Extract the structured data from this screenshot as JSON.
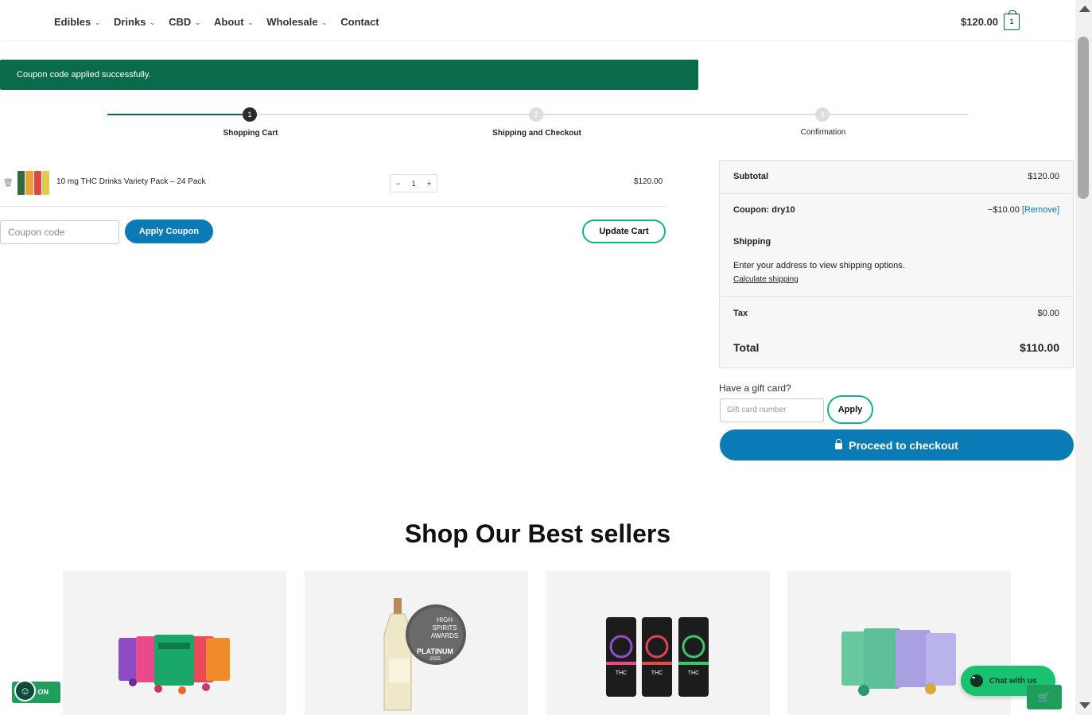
{
  "nav": {
    "items": [
      {
        "label": "Edibles",
        "has_dropdown": true
      },
      {
        "label": "Drinks",
        "has_dropdown": true
      },
      {
        "label": "CBD",
        "has_dropdown": true
      },
      {
        "label": "About",
        "has_dropdown": true
      },
      {
        "label": "Wholesale",
        "has_dropdown": true
      },
      {
        "label": "Contact",
        "has_dropdown": false
      }
    ],
    "cart_total": "$120.00",
    "cart_count": "1"
  },
  "notice": {
    "text": "Coupon code applied successfully."
  },
  "steps": [
    {
      "number": "1",
      "label": "Shopping Cart",
      "state": "active"
    },
    {
      "number": "2",
      "label": "Shipping and Checkout",
      "state": "upcoming"
    },
    {
      "number": "3",
      "label": "Confirmation",
      "state": "upcoming"
    }
  ],
  "cart_item": {
    "name": "10 mg THC Drinks Variety Pack – 24 Pack",
    "quantity": "1",
    "minus": "−",
    "plus": "+",
    "price": "$120.00"
  },
  "coupon": {
    "placeholder": "Coupon code",
    "apply_label": "Apply Coupon",
    "update_label": "Update Cart"
  },
  "totals": {
    "subtotal_label": "Subtotal",
    "subtotal_value": "$120.00",
    "coupon_label": "Coupon: dry10",
    "coupon_value": "−$10.00",
    "remove_label": "[Remove]",
    "shipping_label": "Shipping",
    "shipping_note": "Enter your address to view shipping options.",
    "calc_shipping_label": "Calculate shipping",
    "tax_label": "Tax",
    "tax_value": "$0.00",
    "total_label": "Total",
    "total_value": "$110.00"
  },
  "gift_card": {
    "label": "Have a gift card?",
    "placeholder": "Gift card number",
    "apply_label": "Apply"
  },
  "checkout": {
    "label": "Proceed to checkout"
  },
  "best_sellers": {
    "title": "Shop Our Best sellers",
    "award_text": [
      "HIGH",
      "SPIRITS",
      "AWARDS",
      "PLATINUM",
      "2025"
    ],
    "can_text": "THC"
  },
  "floating": {
    "accessibility_label": ": ON",
    "chat_label": "Chat with us"
  },
  "colors": {
    "brand_green": "#0a6b4c",
    "accent_blue": "#0a7bb5",
    "outline_green": "#0fb58a"
  }
}
